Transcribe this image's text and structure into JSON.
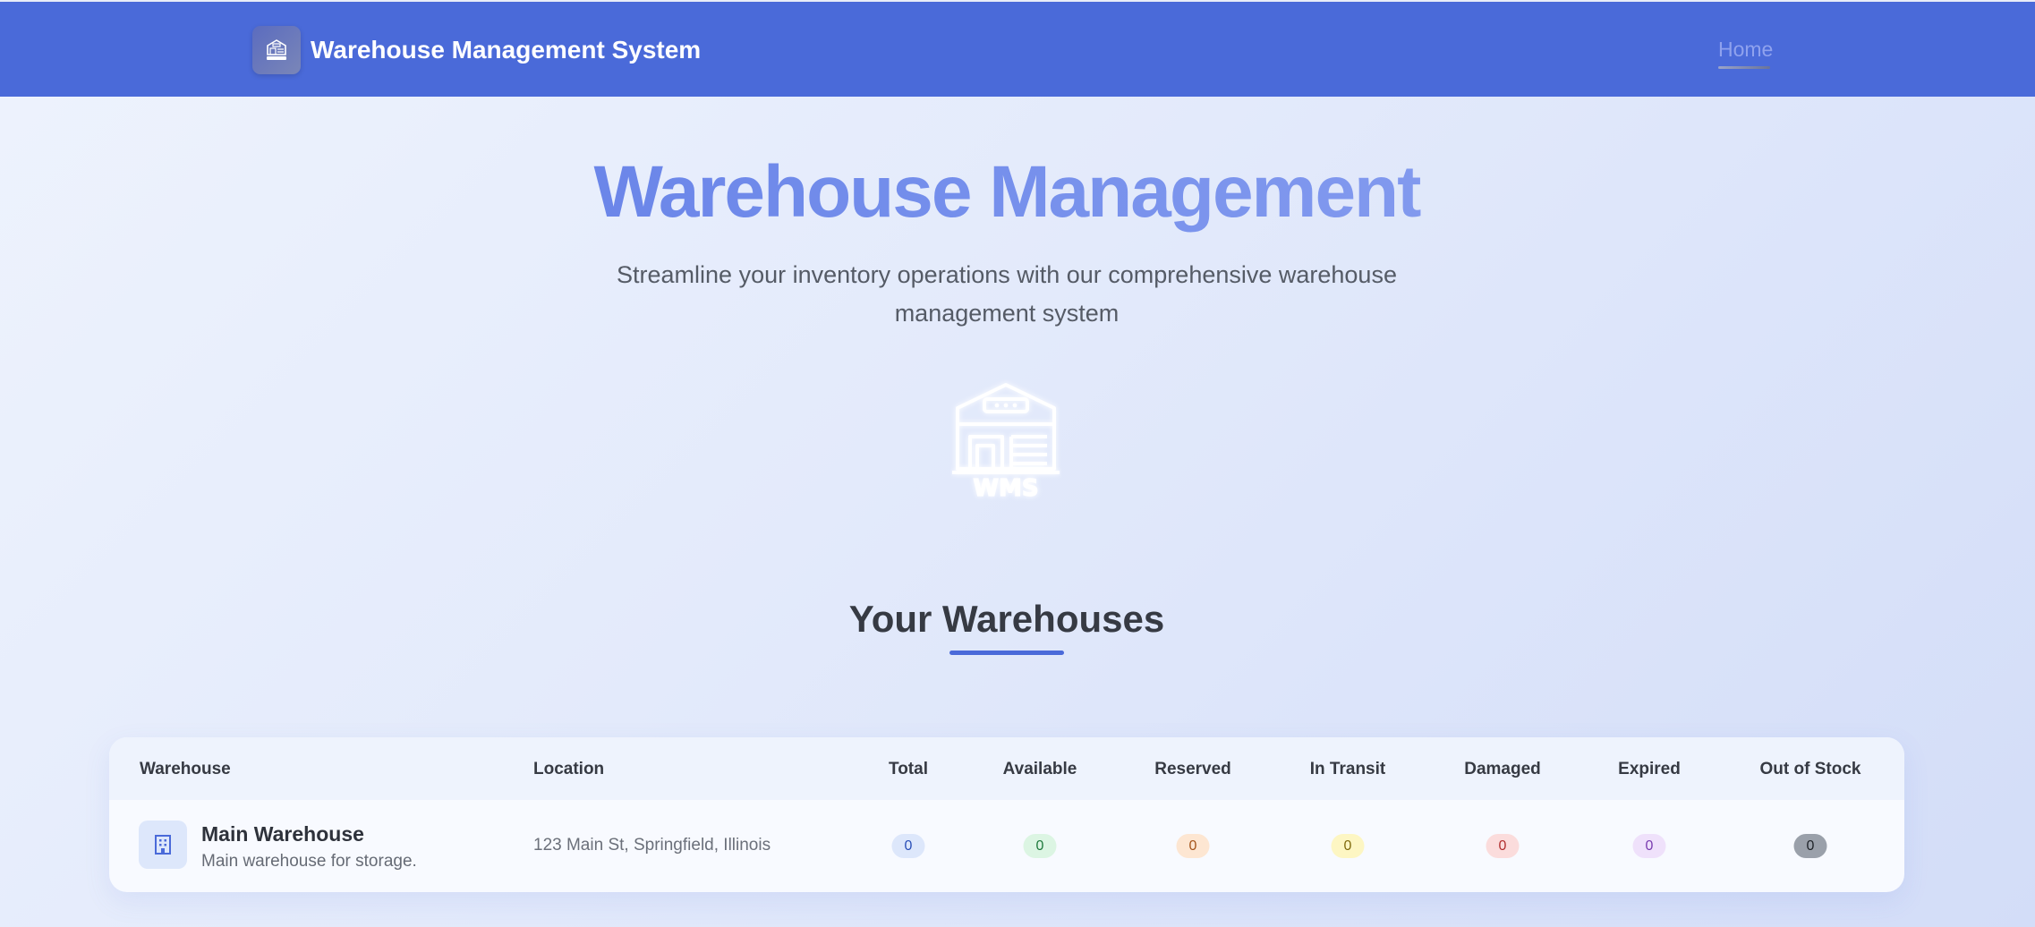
{
  "navbar": {
    "brand_title": "Warehouse Management System",
    "home_link": "Home"
  },
  "hero": {
    "title": "Warehouse Management",
    "subtitle": "Streamline your inventory operations with our comprehensive warehouse management system",
    "logo_text": "WMS"
  },
  "section": {
    "title": "Your Warehouses"
  },
  "table": {
    "headers": {
      "warehouse": "Warehouse",
      "location": "Location",
      "total": "Total",
      "available": "Available",
      "reserved": "Reserved",
      "in_transit": "In Transit",
      "damaged": "Damaged",
      "expired": "Expired",
      "out_of_stock": "Out of Stock"
    },
    "rows": [
      {
        "name": "Main Warehouse",
        "description": "Main warehouse for storage.",
        "location": "123 Main St, Springfield, Illinois",
        "total": "0",
        "available": "0",
        "reserved": "0",
        "in_transit": "0",
        "damaged": "0",
        "expired": "0",
        "out_of_stock": "0"
      }
    ]
  },
  "colors": {
    "navbar": "#4a6ad9",
    "accent": "#4a6ad9",
    "badge_total": "#dde7fb",
    "badge_available": "#dcf5e3",
    "badge_reserved": "#fde6d2",
    "badge_in_transit": "#fdf6c3",
    "badge_damaged": "#fbdcdc",
    "badge_expired": "#efe1fb",
    "badge_out_of_stock": "#9aa0aa"
  }
}
